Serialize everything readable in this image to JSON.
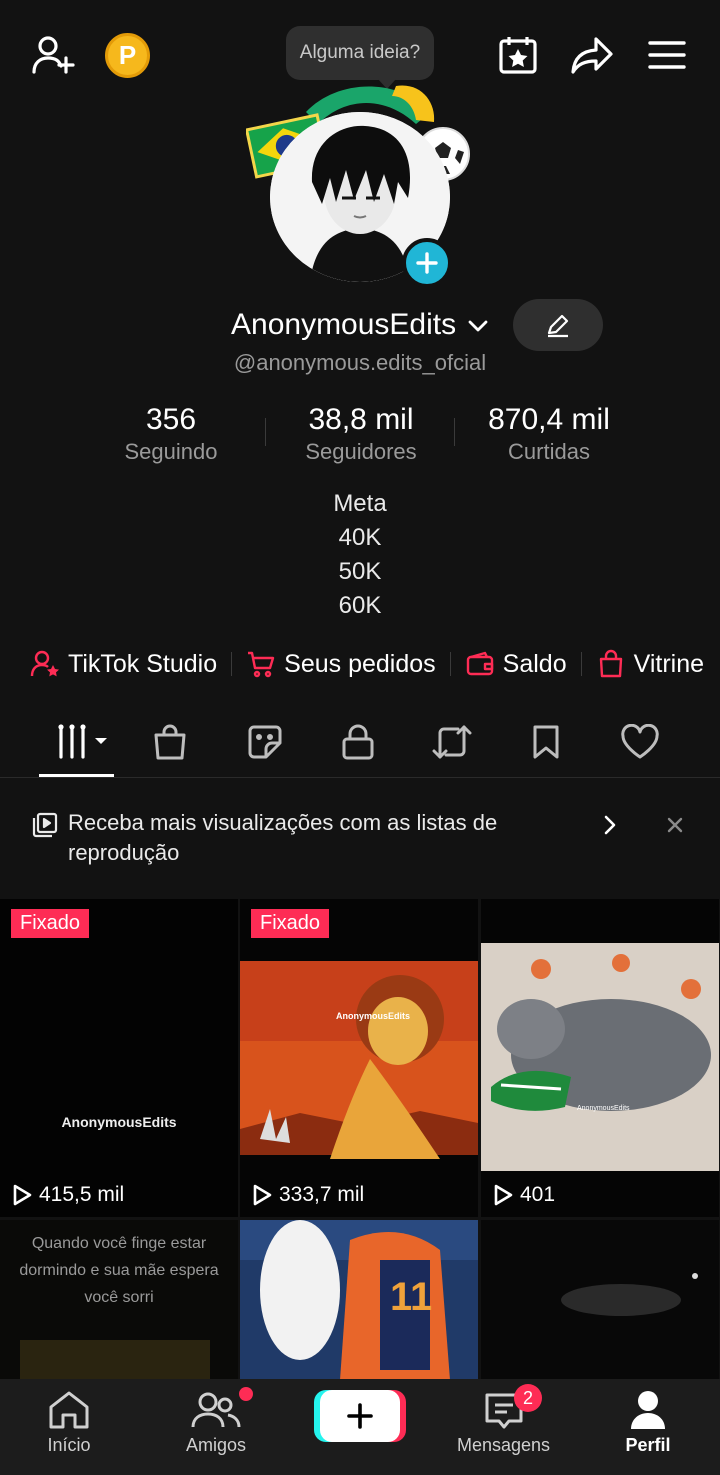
{
  "header": {
    "tooltip": "Alguma ideia?",
    "coin_letter": "P"
  },
  "profile": {
    "name": "AnonymousEdits",
    "handle": "@anonymous.edits_ofcial",
    "stats": [
      {
        "value": "356",
        "label": "Seguindo"
      },
      {
        "value": "38,8 mil",
        "label": "Seguidores"
      },
      {
        "value": "870,4 mil",
        "label": "Curtidas"
      }
    ],
    "bio": [
      "Meta",
      "40K",
      "50K",
      "60K"
    ]
  },
  "quick_links": [
    {
      "label": "TikTok Studio",
      "icon": "person-star-icon"
    },
    {
      "label": "Seus pedidos",
      "icon": "cart-icon"
    },
    {
      "label": "Saldo",
      "icon": "wallet-icon"
    },
    {
      "label": "Vitrine",
      "icon": "bag-icon"
    }
  ],
  "banner": {
    "text": "Receba mais visualizações com as listas de reprodução"
  },
  "videos": [
    {
      "pinned_label": "Fixado",
      "views": "415,5 mil",
      "overlay": "AnonymousEdits"
    },
    {
      "pinned_label": "Fixado",
      "views": "333,7 mil",
      "overlay": "AnonymousEdits"
    },
    {
      "pinned_label": "",
      "views": "401",
      "overlay": "AnonymousEdits"
    },
    {
      "pinned_label": "",
      "views": "",
      "overlay": "Quando você finge estar dormindo e sua mãe espera você sorri"
    },
    {
      "pinned_label": "",
      "views": "",
      "overlay": ""
    },
    {
      "pinned_label": "",
      "views": "",
      "overlay": ""
    }
  ],
  "nav": {
    "home": "Início",
    "friends": "Amigos",
    "messages": "Mensagens",
    "messages_badge": "2",
    "profile": "Perfil"
  },
  "colors": {
    "background": "#121212",
    "accent_pink": "#fe2c55",
    "accent_cyan": "#25f4ee",
    "coin": "#f6b81c"
  }
}
